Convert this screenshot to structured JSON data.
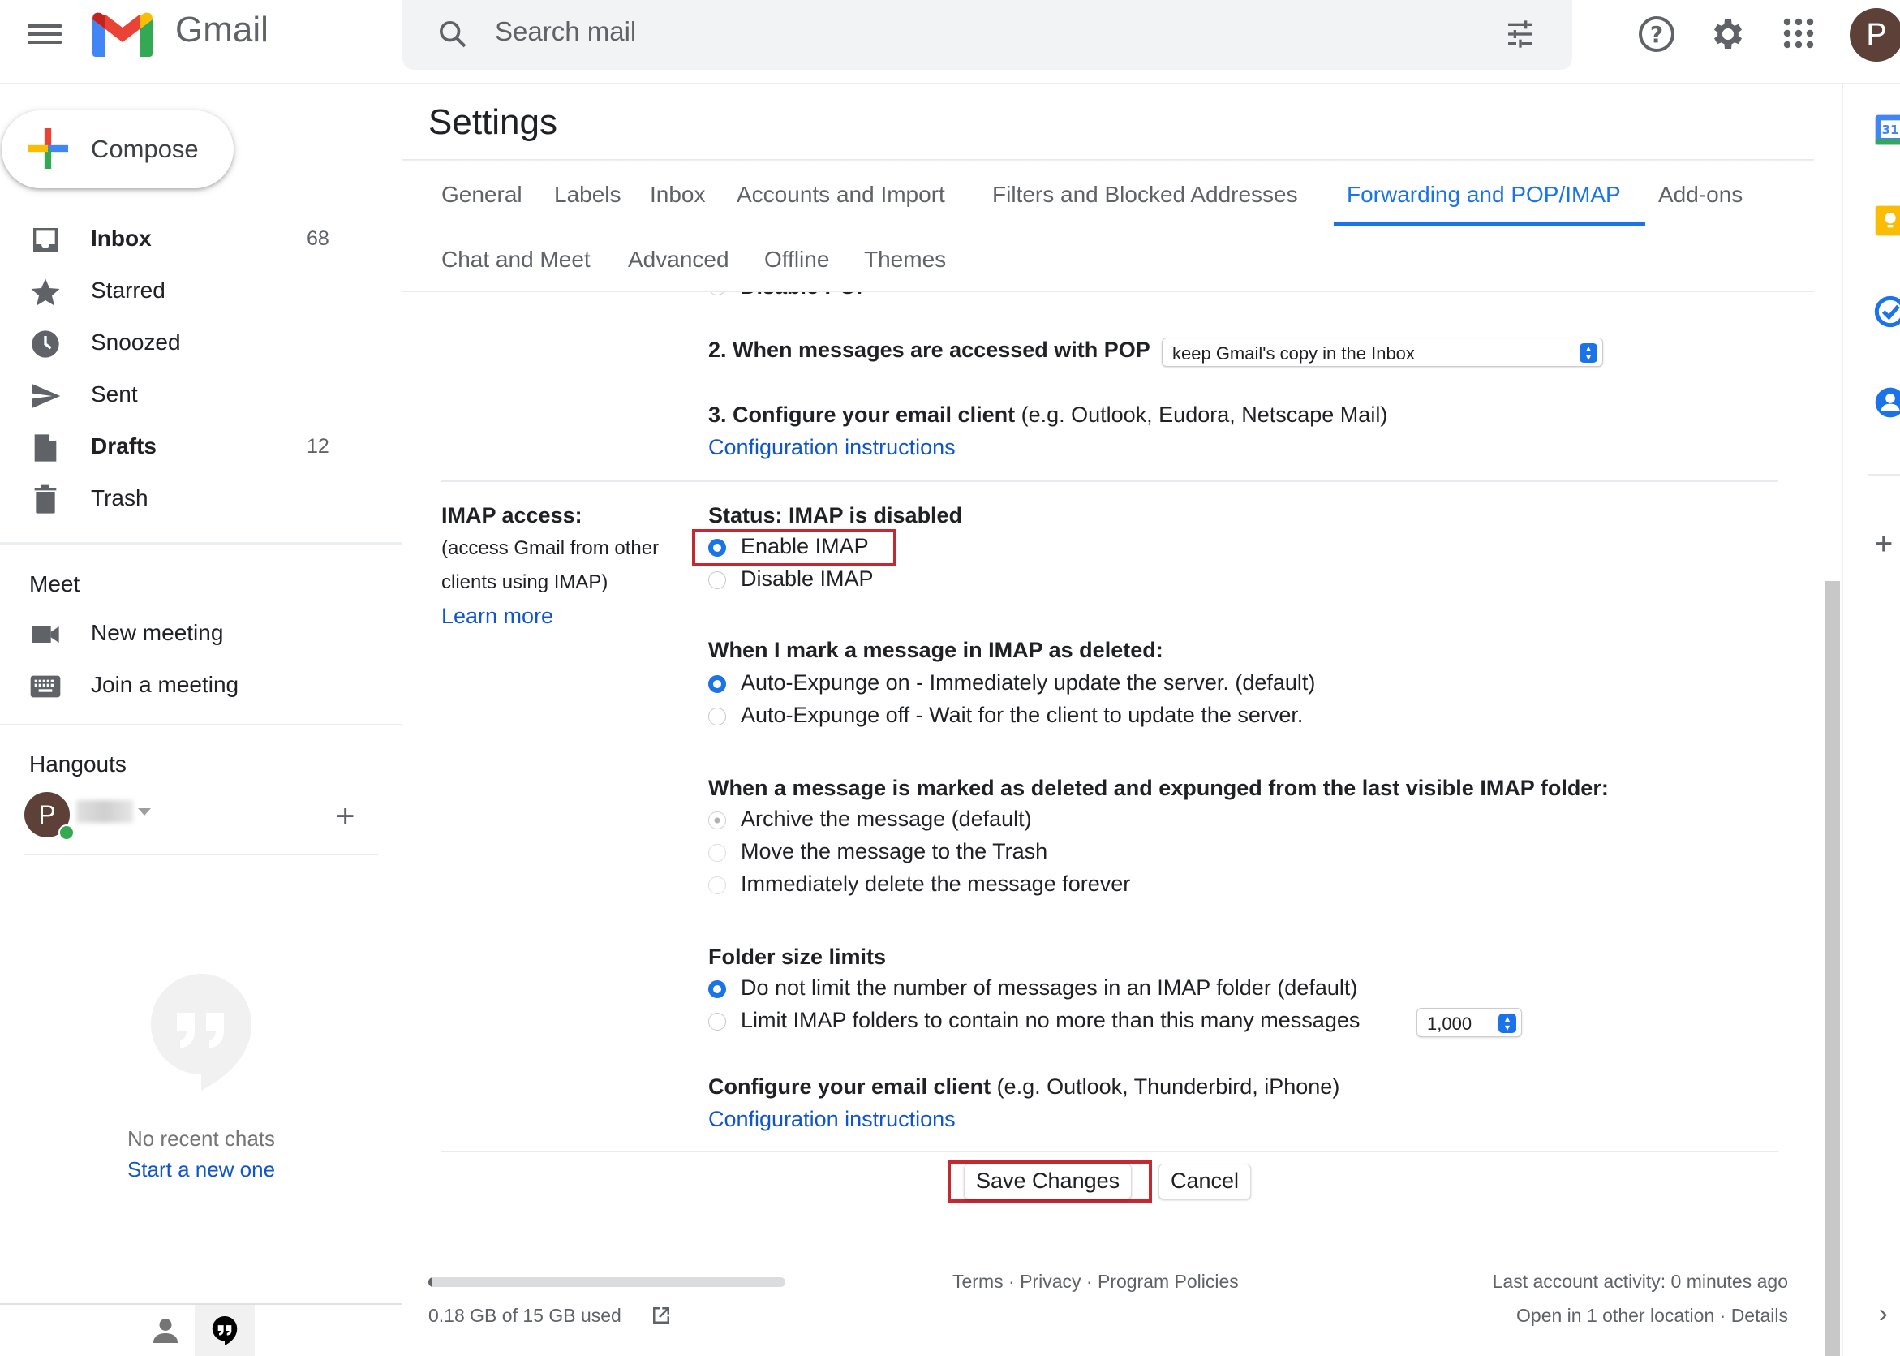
{
  "header": {
    "app_name": "Gmail",
    "search_placeholder": "Search mail",
    "avatar_initial": "P"
  },
  "sidebar": {
    "compose_label": "Compose",
    "items": [
      {
        "label": "Inbox",
        "count": "68",
        "bold": true,
        "icon": "inbox-icon"
      },
      {
        "label": "Starred",
        "count": "",
        "bold": false,
        "icon": "star-icon"
      },
      {
        "label": "Snoozed",
        "count": "",
        "bold": false,
        "icon": "clock-icon"
      },
      {
        "label": "Sent",
        "count": "",
        "bold": false,
        "icon": "send-icon"
      },
      {
        "label": "Drafts",
        "count": "12",
        "bold": true,
        "icon": "draft-icon"
      },
      {
        "label": "Trash",
        "count": "",
        "bold": false,
        "icon": "trash-icon"
      }
    ],
    "meet": {
      "title": "Meet",
      "new_meeting": "New meeting",
      "join_meeting": "Join a meeting"
    },
    "hangouts": {
      "title": "Hangouts",
      "avatar_initial": "P",
      "no_recent": "No recent chats",
      "start_new": "Start a new one"
    }
  },
  "settings": {
    "title": "Settings",
    "tabs_row1": [
      "General",
      "Labels",
      "Inbox",
      "Accounts and Import",
      "Filters and Blocked Addresses",
      "Forwarding and POP/IMAP",
      "Add-ons"
    ],
    "tabs_row2": [
      "Chat and Meet",
      "Advanced",
      "Offline",
      "Themes"
    ],
    "active_tab": "Forwarding and POP/IMAP",
    "pop": {
      "step2_label": "2. When messages are accessed with POP",
      "step2_select": "keep Gmail's copy in the Inbox",
      "step3_bold": "3. Configure your email client",
      "step3_rest": " (e.g. Outlook, Eudora, Netscape Mail)",
      "config_link": "Configuration instructions"
    },
    "imap": {
      "label": "IMAP access:",
      "desc_line1": "(access Gmail from other",
      "desc_line2": "clients using IMAP)",
      "learn_more": "Learn more",
      "status": "Status: IMAP is disabled",
      "enable": "Enable IMAP",
      "disable": "Disable IMAP",
      "enable_selected": true,
      "deleted_title": "When I mark a message in IMAP as deleted:",
      "expunge_on": "Auto-Expunge on - Immediately update the server. (default)",
      "expunge_off": "Auto-Expunge off - Wait for the client to update the server.",
      "expunge_on_selected": true,
      "expunged_title": "When a message is marked as deleted and expunged from the last visible IMAP folder:",
      "archive": "Archive the message (default)",
      "move_trash": "Move the message to the Trash",
      "delete_forever": "Immediately delete the message forever",
      "folder_title": "Folder size limits",
      "no_limit": "Do not limit the number of messages in an IMAP folder (default)",
      "limit": "Limit IMAP folders to contain no more than this many messages",
      "limit_value": "1,000",
      "client_bold": "Configure your email client",
      "client_rest": " (e.g. Outlook, Thunderbird, iPhone)",
      "config_link": "Configuration instructions"
    },
    "save_label": "Save Changes",
    "cancel_label": "Cancel"
  },
  "footer": {
    "storage": "0.18 GB of 15 GB used",
    "storage_fraction": 0.012,
    "terms": "Terms",
    "privacy": "Privacy",
    "policies": "Program Policies",
    "activity": "Last account activity: 0 minutes ago",
    "other_location": "Open in 1 other location",
    "details": "Details"
  },
  "colors": {
    "accent": "#1a73e8",
    "link": "#1155cc",
    "highlight": "#c5282f"
  }
}
